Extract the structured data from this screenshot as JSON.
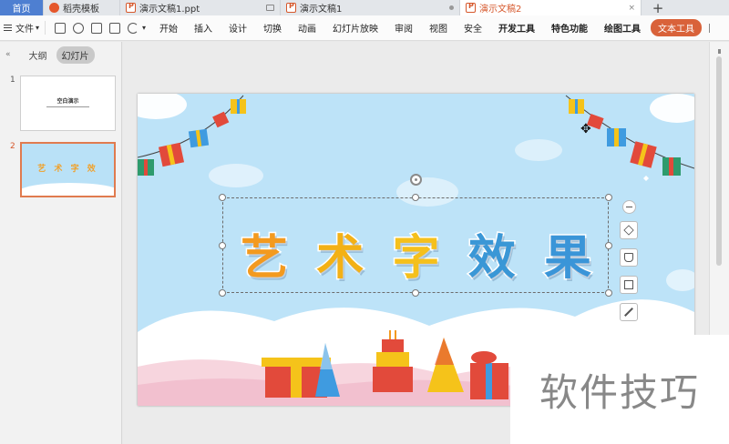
{
  "tabs": [
    {
      "label": "首页",
      "type": "home"
    },
    {
      "label": "稻壳模板",
      "icon": "wps-icon"
    },
    {
      "label": "演示文稿1.ppt",
      "icon": "ppt-icon",
      "indicator": "monitor-icon"
    },
    {
      "label": "演示文稿1",
      "icon": "ppt-icon",
      "indicator": "dot-icon"
    },
    {
      "label": "演示文稿2",
      "icon": "ppt-icon",
      "indicator": "close-icon",
      "active": true
    }
  ],
  "tab_new_label": "+",
  "tab_close_glyph": "×",
  "menu": {
    "file_label": "文件",
    "file_chevron": "▾",
    "undo_chevron": "▾",
    "items": [
      "开始",
      "插入",
      "设计",
      "切换",
      "动画",
      "幻灯片放映",
      "审阅",
      "视图",
      "安全",
      "开发工具",
      "特色功能",
      "绘图工具"
    ],
    "bold_items": [
      "开发工具",
      "特色功能",
      "绘图工具"
    ],
    "active_tag": "文本工具"
  },
  "left_panel": {
    "collapse_glyph": "«",
    "tabs": [
      {
        "label": "大纲",
        "active": false
      },
      {
        "label": "幻灯片",
        "active": true
      }
    ],
    "thumbnails": [
      {
        "number": "1",
        "title": "空白演示",
        "selected": false
      },
      {
        "number": "2",
        "title": "艺 术 字 效",
        "selected": true
      }
    ]
  },
  "slide": {
    "wordart_chars": [
      "艺",
      "术",
      "字",
      "效",
      "果"
    ],
    "background_color": "#bde3f8"
  },
  "watermark": "软件技巧",
  "colors": {
    "accent": "#d6582c",
    "home_tab": "#4e7fd1",
    "tag_bg": "#d9623a"
  }
}
